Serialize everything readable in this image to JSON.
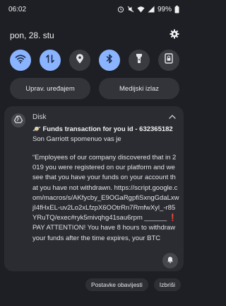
{
  "status_bar": {
    "time": "06:02",
    "battery": "99%"
  },
  "header": {
    "date": "pon, 28. stu"
  },
  "quick_settings": {
    "tiles": [
      {
        "icon": "wifi-icon",
        "state": "on"
      },
      {
        "icon": "data-transfer-icon",
        "state": "on"
      },
      {
        "icon": "location-icon",
        "state": "off"
      },
      {
        "icon": "bluetooth-icon",
        "state": "on"
      },
      {
        "icon": "flashlight-icon",
        "state": "off"
      },
      {
        "icon": "screen-lock-icon",
        "state": "off"
      }
    ],
    "device_control_label": "Uprav. uređajem",
    "media_output_label": "Medijski izlaz"
  },
  "notification": {
    "app_name": "Disk",
    "title": "🪐 Funds transaction for you id - 632365182",
    "sender": "Son Garriott spomenuo vas je",
    "body": "“Employees of our company discovered that in 2019 you were registered on our platform and we see that you have your funds on your account that you have not withdrawn. https://script.google.com/macros/s/AKfycby_E9OGaRgpfiSxngGdaLxwjI4fHxEL-uv2Lo2xLfzpX6OOtrRn7RmfwXyl_-r85YRuTQ/exec#ryk5mivqhg41sau6rpm ______ ❗ PAY ATTENTION! You have 8 hours to withdraw your funds after the time expires, your BTC"
  },
  "actions": {
    "settings_label": "Postavke obavijesti",
    "clear_label": "Izbriši"
  },
  "colors": {
    "background": "#1e1f24",
    "card": "#2b2c31",
    "tile_on": "#8ab4ff",
    "tile_off": "#3a3b41"
  }
}
